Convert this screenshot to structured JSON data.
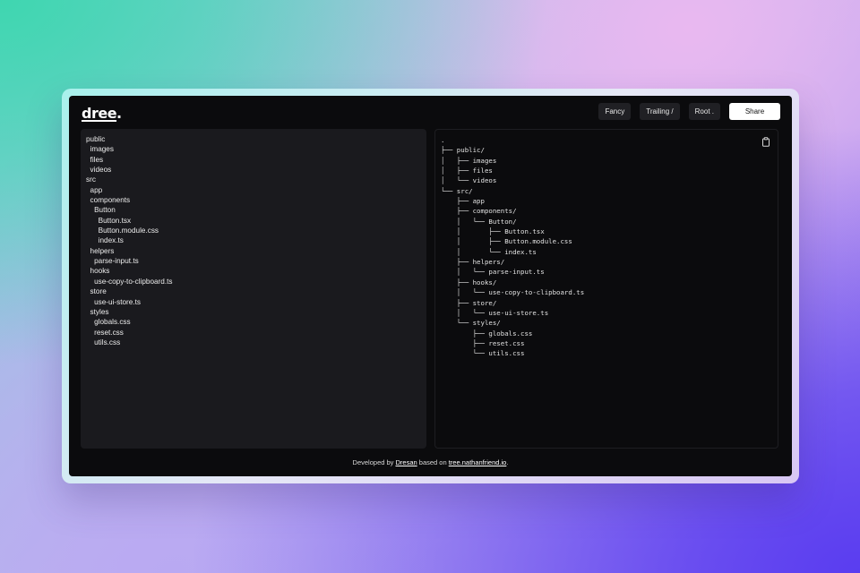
{
  "logo": {
    "text": "dree",
    "suffix": "."
  },
  "toolbar": {
    "fancy_label": "Fancy",
    "trailing_label": "Trailing /",
    "root_label": "Root .",
    "share_label": "Share"
  },
  "input_lines": [
    "public",
    "  images",
    "  files",
    "  videos",
    "src",
    "  app",
    "  components",
    "    Button",
    "      Button.tsx",
    "      Button.module.css",
    "      index.ts",
    "  helpers",
    "    parse-input.ts",
    "  hooks",
    "    use-copy-to-clipboard.ts",
    "  store",
    "    use-ui-store.ts",
    "  styles",
    "    globals.css",
    "    reset.css",
    "    utils.css"
  ],
  "output_lines": [
    ".",
    "├── public/",
    "│   ├── images",
    "│   ├── files",
    "│   └── videos",
    "└── src/",
    "    ├── app",
    "    ├── components/",
    "    │   └── Button/",
    "    │       ├── Button.tsx",
    "    │       ├── Button.module.css",
    "    │       └── index.ts",
    "    ├── helpers/",
    "    │   └── parse-input.ts",
    "    ├── hooks/",
    "    │   └── use-copy-to-clipboard.ts",
    "    ├── store/",
    "    │   └── use-ui-store.ts",
    "    └── styles/",
    "        ├── globals.css",
    "        ├── reset.css",
    "        └── utils.css"
  ],
  "footer": {
    "prefix": "Developed by ",
    "author": "Dresan",
    "middle": " based on ",
    "link": "tree.nathanfriend.io",
    "suffix": "."
  },
  "icons": {
    "copy": "clipboard-icon"
  }
}
